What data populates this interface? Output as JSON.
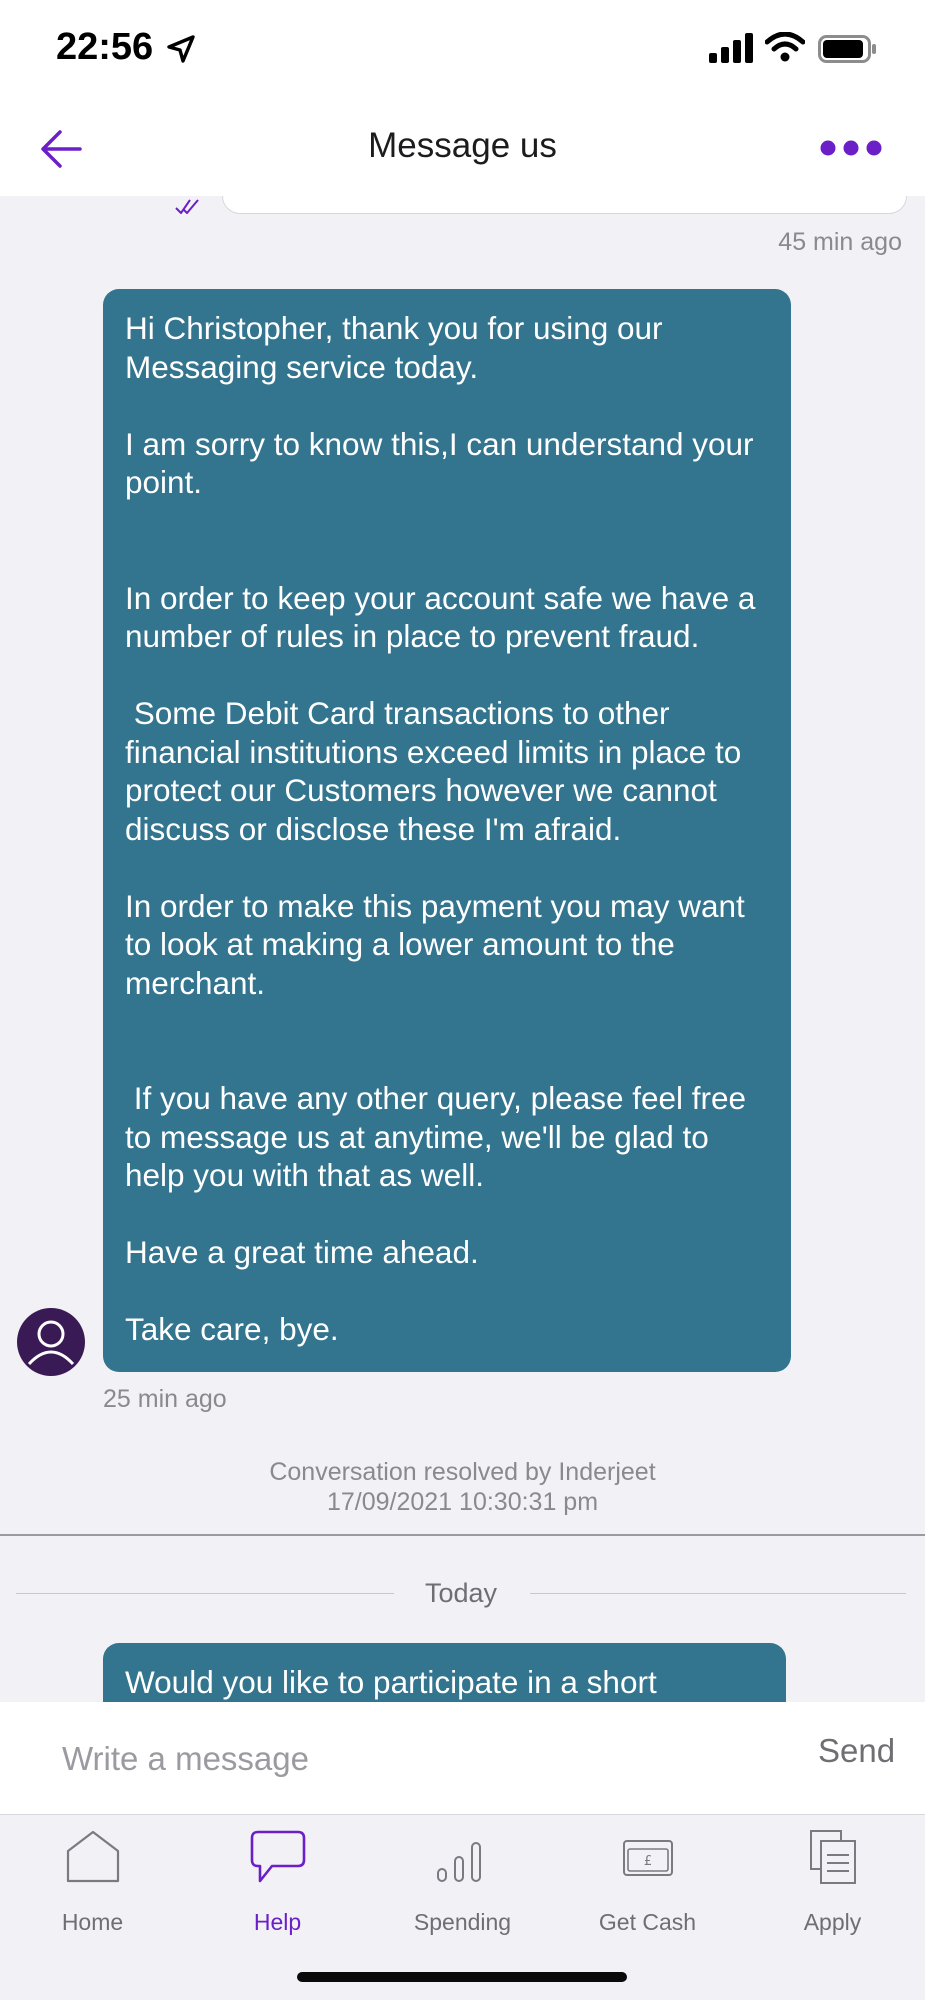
{
  "status_bar": {
    "time": "22:56"
  },
  "header": {
    "title": "Message us"
  },
  "chat": {
    "prev_timestamp": "45 min ago",
    "agent_message": {
      "paragraphs": [
        "Hi Christopher, thank you for using our Messaging service today.\n\nI am sorry to know this,I can understand your point.\n\n\nIn order to keep your account safe we have a number of rules in place to prevent fraud.\n\n Some Debit Card transactions to other financial institutions exceed limits in place to protect our Customers however we cannot discuss or disclose these I'm afraid.\n\nIn order to make this payment you may want to look at making a lower amount to the merchant.\n\n\n If you have any other query, please feel free to message us at anytime, we'll be glad to help you with that as well.\n\nHave a great time ahead.\n\nTake care, bye."
      ],
      "timestamp": "25 min ago"
    },
    "resolved": {
      "line1": "Conversation resolved by Inderjeet",
      "line2": "17/09/2021 10:30:31 pm"
    },
    "date_separator": "Today",
    "survey_message": "Would you like to participate in a short"
  },
  "composer": {
    "placeholder": "Write a message",
    "send_label": "Send"
  },
  "tabs": [
    {
      "label": "Home",
      "icon": "home-icon",
      "active": false
    },
    {
      "label": "Help",
      "icon": "speech-bubble-icon",
      "active": true
    },
    {
      "label": "Spending",
      "icon": "bar-chart-icon",
      "active": false
    },
    {
      "label": "Get Cash",
      "icon": "cash-icon",
      "active": false
    },
    {
      "label": "Apply",
      "icon": "documents-icon",
      "active": false
    }
  ],
  "colors": {
    "accent": "#6b1fc7",
    "agent_bubble": "#33748f",
    "background": "#f2f1f6"
  }
}
